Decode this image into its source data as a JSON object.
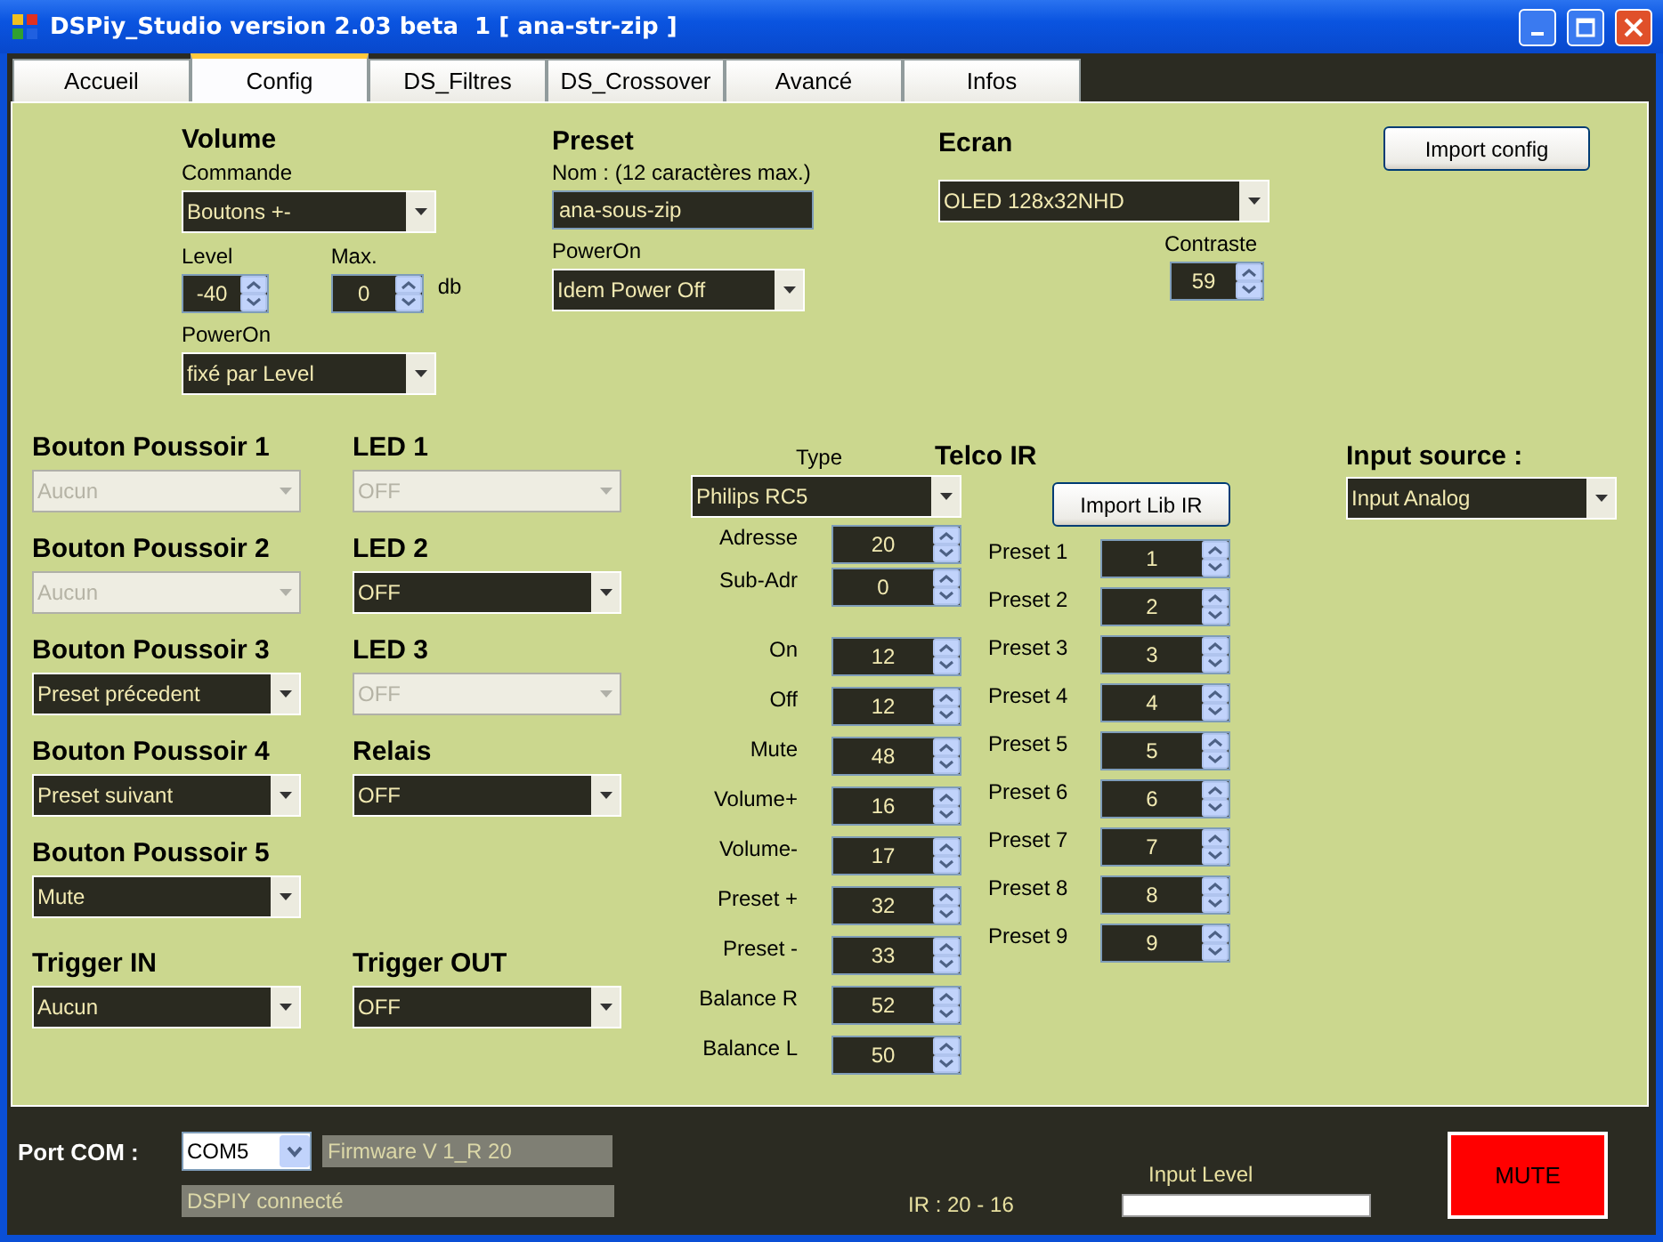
{
  "window": {
    "title": "DSPiy_Studio version 2.03 beta  1 [ ana-str-zip ]"
  },
  "tabs": [
    {
      "label": "Accueil",
      "selected": false
    },
    {
      "label": "Config",
      "selected": true
    },
    {
      "label": "DS_Filtres",
      "selected": false
    },
    {
      "label": "DS_Crossover",
      "selected": false
    },
    {
      "label": "Avancé",
      "selected": false
    },
    {
      "label": "Infos",
      "selected": false
    }
  ],
  "volume": {
    "title": "Volume",
    "command_label": "Commande",
    "command_value": "Boutons +-",
    "level_label": "Level",
    "level_value": "-40",
    "max_label": "Max.",
    "max_value": "0",
    "unit": "db",
    "poweron_label": "PowerOn",
    "poweron_value": "fixé par Level"
  },
  "preset": {
    "title": "Preset",
    "name_label": "Nom : (12 caractères max.)",
    "name_value": "ana-sous-zip",
    "poweron_label": "PowerOn",
    "poweron_value": "Idem Power Off"
  },
  "ecran": {
    "title": "Ecran",
    "value": "OLED 128x32NHD",
    "contrast_label": "Contraste",
    "contrast_value": "59"
  },
  "import_config": "Import config",
  "io_rows": [
    {
      "left": {
        "label": "Bouton Poussoir 1",
        "value": "Aucun",
        "disabled": true
      },
      "right": {
        "label": "LED 1",
        "value": "OFF",
        "disabled": true
      }
    },
    {
      "left": {
        "label": "Bouton Poussoir 2",
        "value": "Aucun",
        "disabled": true
      },
      "right": {
        "label": "LED 2",
        "value": "OFF",
        "disabled": false
      }
    },
    {
      "left": {
        "label": "Bouton Poussoir 3",
        "value": "Preset précedent",
        "disabled": false
      },
      "right": {
        "label": "LED 3",
        "value": "OFF",
        "disabled": true
      }
    },
    {
      "left": {
        "label": "Bouton Poussoir 4",
        "value": "Preset suivant",
        "disabled": false
      },
      "right": {
        "label": "Relais",
        "value": "OFF",
        "disabled": false
      }
    },
    {
      "left": {
        "label": "Bouton Poussoir 5",
        "value": "Mute",
        "disabled": false
      }
    },
    {
      "left": {
        "label": "Trigger IN",
        "value": "Aucun",
        "disabled": false
      },
      "right": {
        "label": "Trigger OUT",
        "value": "OFF",
        "disabled": false
      }
    }
  ],
  "ir": {
    "type_label": "Type",
    "type_value": "Philips RC5",
    "title": "Telco IR",
    "import_button": "Import Lib IR",
    "address_codes": [
      {
        "label": "Adresse",
        "value": "20"
      },
      {
        "label": "Sub-Adr",
        "value": "0"
      }
    ],
    "command_codes": [
      {
        "label": "On",
        "value": "12"
      },
      {
        "label": "Off",
        "value": "12"
      },
      {
        "label": "Mute",
        "value": "48"
      },
      {
        "label": "Volume+",
        "value": "16"
      },
      {
        "label": "Volume-",
        "value": "17"
      },
      {
        "label": "Preset +",
        "value": "32"
      },
      {
        "label": "Preset -",
        "value": "33"
      },
      {
        "label": "Balance R",
        "value": "52"
      },
      {
        "label": "Balance L",
        "value": "50"
      }
    ],
    "presets": [
      {
        "label": "Preset 1",
        "value": "1"
      },
      {
        "label": "Preset 2",
        "value": "2"
      },
      {
        "label": "Preset 3",
        "value": "3"
      },
      {
        "label": "Preset 4",
        "value": "4"
      },
      {
        "label": "Preset 5",
        "value": "5"
      },
      {
        "label": "Preset 6",
        "value": "6"
      },
      {
        "label": "Preset 7",
        "value": "7"
      },
      {
        "label": "Preset 8",
        "value": "8"
      },
      {
        "label": "Preset 9",
        "value": "9"
      }
    ]
  },
  "input_source": {
    "title": "Input source :",
    "value": "Input Analog"
  },
  "status_bar": {
    "port_label": "Port COM :",
    "port_value": "COM5",
    "firmware": "Firmware V 1_R 20",
    "connection": "DSPIY connecté",
    "ir_reading": "IR : 20 - 16",
    "input_level_label": "Input Level",
    "mute_button": "MUTE"
  }
}
